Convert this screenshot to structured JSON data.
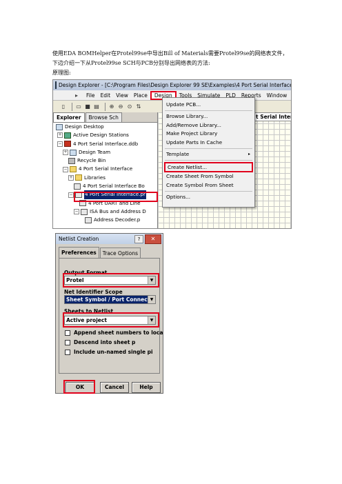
{
  "doc": {
    "line1": "使用EDA  BOMHelper在Protel99se中导出Bill of Materials需要Protel99se的网络表文件，",
    "line2": "下边介绍一下从Protel99se SCH与PCB分别导出网络表的方法:",
    "line3": "原理图:"
  },
  "shot1": {
    "window_title": "Design Explorer - [C:\\Program Files\\Design Explorer 99 SE\\Examples\\4 Port Serial Interface.ddb",
    "menu": [
      "File",
      "Edit",
      "View",
      "Place",
      "Design",
      "Tools",
      "Simulate",
      "PLD",
      "Reports",
      "Window"
    ],
    "menu_active_index": 4,
    "panel_tabs": [
      "Explorer",
      "Browse Sch"
    ],
    "tree": [
      {
        "label": "Design Desktop",
        "icon": "desktop"
      },
      {
        "label": "Active Design Stations",
        "icon": "stations"
      },
      {
        "label": "4 Port Serial Interface.ddb",
        "icon": "database"
      },
      {
        "label": "Design Team",
        "icon": "team"
      },
      {
        "label": "Recycle Bin",
        "icon": "recycle-bin"
      },
      {
        "label": "4 Port Serial Interface",
        "icon": "folder"
      },
      {
        "label": "Libraries",
        "icon": "folder"
      },
      {
        "label": "4 Port Serial Interface Bo",
        "icon": "pcb-doc"
      },
      {
        "label": "4 Port Serial Interface.pr",
        "icon": "schematic-doc",
        "selected": true
      },
      {
        "label": "4 Port UART and Line",
        "icon": "schematic-doc"
      },
      {
        "label": "ISA Bus and Address D",
        "icon": "schematic-doc"
      },
      {
        "label": "Address Decoder.p",
        "icon": "schematic-doc"
      }
    ],
    "doc_tab": "t Serial Interf",
    "design_menu": {
      "items": [
        "Update PCB...",
        "Browse Library...",
        "Add/Remove Library...",
        "Make Project Library",
        "Update Parts In Cache",
        "Template",
        "Create Netlist...",
        "Create Sheet From Symbol",
        "Create Symbol From Sheet",
        "Options..."
      ],
      "highlighted": "Create Netlist...",
      "submenu_arrow": "▸"
    }
  },
  "shot2": {
    "dialog_title": "Netlist Creation",
    "help_button": "?",
    "close_button": "✕",
    "tabs": [
      "Preferences",
      "Trace Options"
    ],
    "output_format_label": "Output Format",
    "output_format_value": "Protel",
    "net_scope_label": "Net Identifier Scope",
    "net_scope_value": "Sheet Symbol / Port Connecti",
    "sheets_label": "Sheets to Netlist",
    "sheets_value": "Active project",
    "checkboxes": [
      "Append sheet numbers to loca",
      "Descend into sheet p",
      "Include un-named single pi"
    ],
    "buttons": {
      "ok": "OK",
      "cancel": "Cancel",
      "help": "Help"
    }
  },
  "colors": {
    "highlight_red": "#e0001b",
    "selection_blue": "#0a246a"
  }
}
